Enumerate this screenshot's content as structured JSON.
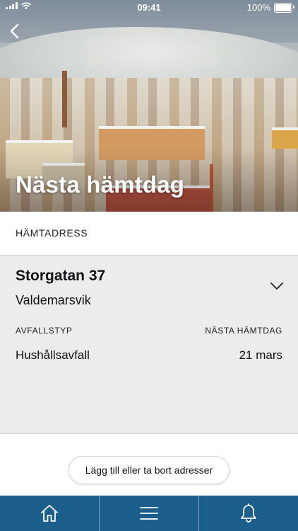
{
  "status_bar": {
    "time": "09:41",
    "battery": "100%"
  },
  "header": {
    "title": "Nästa hämtdag"
  },
  "address_section": {
    "label": "HÄMTADRESS"
  },
  "address": {
    "street": "Storgatan 37",
    "city": "Valdemarsvik",
    "columns": {
      "waste_type_label": "AVFALLSTYP",
      "next_pickup_label": "NÄSTA HÄMTDAG"
    },
    "rows": [
      {
        "waste_type": "Hushållsavfall",
        "next_pickup": "21 mars"
      }
    ]
  },
  "manage_button": {
    "label": "Lägg till eller ta bort adresser"
  },
  "tab_bar": {
    "tabs": [
      {
        "icon": "home-icon"
      },
      {
        "icon": "menu-icon"
      },
      {
        "icon": "bell-icon"
      }
    ]
  },
  "colors": {
    "tab_bar": "#1b5e8c",
    "card_background": "#ebecee"
  }
}
